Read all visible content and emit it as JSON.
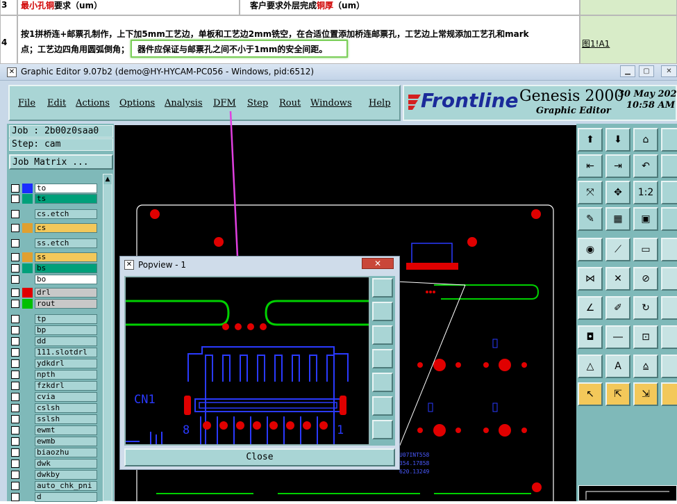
{
  "sheet": {
    "row3_num": "3",
    "row3_col1_red": "最小孔铜",
    "row3_col1_rest": "要求（um）",
    "row3_col2_black": "客户要求外层完成",
    "row3_col2_red": "铜厚",
    "row3_col2_tail": "（um）",
    "row4_num": "4",
    "row4_text_line1": "按1拼桥连+邮票孔制作，上下加5mm工艺边，单板和工艺边2mm铣空，在合适位置添加桥连邮票孔，工艺边上常规添加工艺孔和mark",
    "row4_text_line2a": "点；工艺边四角用圆弧倒角；",
    "row4_text_highlight": "器件应保证与邮票孔之间不小于1mm的安全间距。",
    "row4_link": "图1!A1"
  },
  "window": {
    "title": "Graphic Editor 9.07b2 (demo@HY-HYCAM-PC056 - Windows, pid:6512)"
  },
  "menu": {
    "file": "File",
    "edit": "Edit",
    "actions": "Actions",
    "options": "Options",
    "analysis": "Analysis",
    "dfm": "DFM",
    "step": "Step",
    "rout": "Rout",
    "windows": "Windows",
    "help": "Help"
  },
  "logo": {
    "brand": "Frontline",
    "product": "Genesis 2000",
    "subtitle": "Graphic Editor",
    "date": "30 May 202",
    "time": "10:58 AM"
  },
  "job": {
    "job_label": "Job : 2b00z0saa0",
    "step_label": "Step: cam",
    "matrix_btn": "Job Matrix ..."
  },
  "layers": [
    {
      "name": "to",
      "color": "#1a2cff",
      "bg": "#ffffff"
    },
    {
      "name": "ts",
      "color": "#00a07a",
      "bg": "#00a07a"
    },
    {
      "name": "cs.etch",
      "color": "",
      "bg": "#a9d5d5"
    },
    {
      "name": "cs",
      "color": "#e0a030",
      "bg": "#f3c85a"
    },
    {
      "name": "ss.etch",
      "color": "",
      "bg": "#a9d5d5"
    },
    {
      "name": "ss",
      "color": "#e0a030",
      "bg": "#f3c85a"
    },
    {
      "name": "bs",
      "color": "#00a07a",
      "bg": "#00a07a"
    },
    {
      "name": "bo",
      "color": "",
      "bg": "#ffffff"
    },
    {
      "name": "drl",
      "color": "#e00000",
      "bg": "#c8c8c8"
    },
    {
      "name": "rout",
      "color": "#00c000",
      "bg": "#c8c8c8"
    },
    {
      "name": "tp",
      "color": "",
      "bg": "#a9d5d5"
    },
    {
      "name": "bp",
      "color": "",
      "bg": "#a9d5d5"
    },
    {
      "name": "dd",
      "color": "",
      "bg": "#a9d5d5"
    },
    {
      "name": "111.slotdrl",
      "color": "",
      "bg": "#a9d5d5"
    },
    {
      "name": "ydkdrl",
      "color": "",
      "bg": "#a9d5d5"
    },
    {
      "name": "npth",
      "color": "",
      "bg": "#a9d5d5"
    },
    {
      "name": "fzkdrl",
      "color": "",
      "bg": "#a9d5d5"
    },
    {
      "name": "cvia",
      "color": "",
      "bg": "#a9d5d5"
    },
    {
      "name": "cslsh",
      "color": "",
      "bg": "#a9d5d5"
    },
    {
      "name": "sslsh",
      "color": "",
      "bg": "#a9d5d5"
    },
    {
      "name": "ewmt",
      "color": "",
      "bg": "#a9d5d5"
    },
    {
      "name": "ewmb",
      "color": "",
      "bg": "#a9d5d5"
    },
    {
      "name": "biaozhu",
      "color": "",
      "bg": "#a9d5d5"
    },
    {
      "name": "dwk",
      "color": "",
      "bg": "#a9d5d5"
    },
    {
      "name": "dwkby",
      "color": "",
      "bg": "#a9d5d5"
    },
    {
      "name": "auto_chk_pni",
      "color": "",
      "bg": "#a9d5d5"
    },
    {
      "name": "d",
      "color": "",
      "bg": "#a9d5d5"
    }
  ],
  "popview": {
    "title": "Popview - 1",
    "close_x": "✕",
    "close_btn": "Close",
    "component_label": "CN1",
    "pin_left": "8",
    "pin_right": "1"
  },
  "canvas_text": {
    "t1": "U07INT558",
    "t2": "354.17858",
    "t3": "620.13249"
  }
}
